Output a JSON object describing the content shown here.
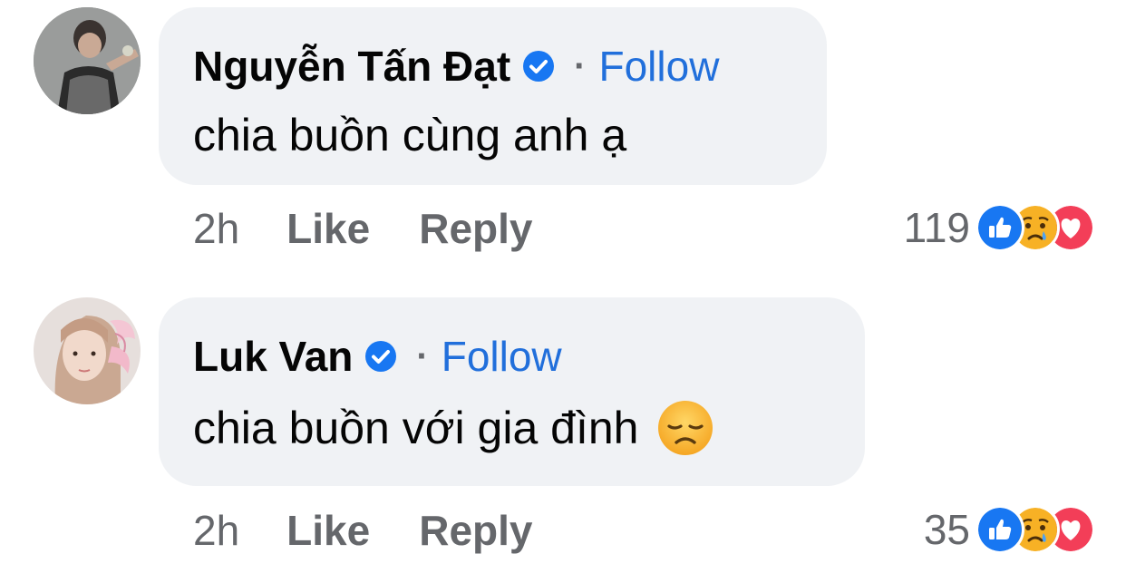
{
  "comments": [
    {
      "author": "Nguyễn Tấn Đạt",
      "verified_icon": "verified-badge-icon",
      "separator": "·",
      "follow_label": "Follow",
      "text": "chia buồn cùng anh ạ",
      "time": "2h",
      "like_label": "Like",
      "reply_label": "Reply",
      "reaction_count": "119",
      "reactions": [
        "like-icon",
        "sad-icon",
        "love-icon"
      ]
    },
    {
      "author": "Luk Van",
      "verified_icon": "verified-badge-icon",
      "separator": "·",
      "follow_label": "Follow",
      "text": "chia buồn với gia đình",
      "text_emoji": "disappointed-face-emoji",
      "time": "2h",
      "like_label": "Like",
      "reply_label": "Reply",
      "reaction_count": "35",
      "reactions": [
        "like-icon",
        "sad-icon",
        "love-icon"
      ]
    }
  ],
  "colors": {
    "bubble": "#f0f2f5",
    "follow_link": "#216fdb",
    "secondary_text": "#65676b",
    "primary_text": "#050505",
    "verified": "#1877f2",
    "like": "#1877f2",
    "love": "#f33e58",
    "sad": "#f7b125"
  }
}
